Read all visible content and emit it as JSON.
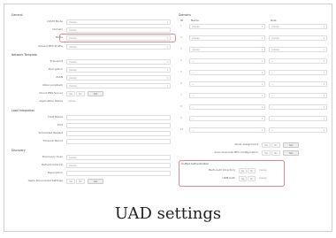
{
  "caption": "UAD settings",
  "left": {
    "sections": {
      "general": "General",
      "network": "Network Template",
      "load": "Load Integration",
      "discovery": "Discovery"
    },
    "general_rows": [
      {
        "label": "CSVM Mode",
        "value": "(none)"
      },
      {
        "label": "Domain",
        "value": "(none)"
      },
      {
        "label": "Mode",
        "value": "(none)"
      },
      {
        "label": "Shared MFA Profile",
        "value": "(none)"
      }
    ],
    "network_rows": [
      {
        "label": "Transport",
        "value": "(none)"
      },
      {
        "label": "Encryption",
        "value": "(none)"
      },
      {
        "label": "VLAN",
        "value": "(none)"
      },
      {
        "label": "Allow Loopback",
        "value": "(none)"
      }
    ],
    "toggle_row": {
      "label": "Cloud DNS Server",
      "yes": "Yes",
      "no": "No",
      "button": "Test"
    },
    "extra_row": {
      "label": "Application Name",
      "value": "(none)"
    },
    "load_rows": [
      {
        "label": "Host Name"
      },
      {
        "label": "Port"
      },
      {
        "label": "Scheduled Restart"
      },
      {
        "label": "Timeout Period"
      }
    ],
    "discovery_rows": [
      {
        "label": "Discovery Scan",
        "value": "(none)"
      },
      {
        "label": "Refresh Interval",
        "value": "(none)"
      },
      {
        "label": "Description"
      }
    ],
    "bottom_row": {
      "label": "Apply Discovered Settings",
      "yes": "Yes",
      "no": "No",
      "button": "Test"
    }
  },
  "right": {
    "section": "Domains",
    "col_id": "ID",
    "col_name": "Name",
    "col_role": "Role",
    "rows": [
      {
        "n": "1",
        "name": "(none)",
        "role": "(none)"
      },
      {
        "n": "2",
        "name": "(none)",
        "role": "(none)"
      },
      {
        "n": "3",
        "name": "(none)",
        "role": "(none)"
      },
      {
        "n": "4",
        "name": "—",
        "role": "—"
      },
      {
        "n": "5",
        "name": "—",
        "role": "—"
      },
      {
        "n": "6",
        "name": "—",
        "role": "—"
      },
      {
        "n": "7",
        "name": "—",
        "role": "—"
      },
      {
        "n": "8",
        "name": "—",
        "role": "—"
      },
      {
        "n": "9",
        "name": "—",
        "role": "—"
      },
      {
        "n": "10",
        "name": "—",
        "role": "—"
      }
    ],
    "opt1": {
      "label": "Allow Assignment",
      "yes": "Yes",
      "no": "No",
      "button": "Test"
    },
    "opt2": {
      "label": "Auto-Override MFA Configuration",
      "yes": "Yes",
      "no": "No",
      "button": "Test"
    },
    "uad": {
      "section": "Unified Authentication",
      "row1": {
        "label": "Multi-Auth Directory",
        "yes": "Yes",
        "no": "No",
        "extra": "(none)"
      },
      "row2": {
        "label": "UDB Auth",
        "yes": "Yes",
        "no": "No",
        "extra": "(none)"
      }
    }
  }
}
